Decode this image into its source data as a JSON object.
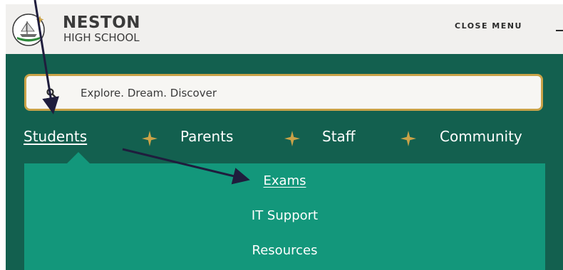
{
  "header": {
    "school_name": "NESTON",
    "school_subtitle": "HIGH SCHOOL",
    "close_menu_label": "CLOSE MENU"
  },
  "search": {
    "placeholder": "Explore. Dream. Discover"
  },
  "nav": {
    "items": [
      {
        "label": "Students",
        "active": true
      },
      {
        "label": "Parents"
      },
      {
        "label": "Staff"
      },
      {
        "label": "Community"
      }
    ],
    "separator_icon": "star-icon"
  },
  "submenu": {
    "items": [
      {
        "label": "Exams",
        "current": true
      },
      {
        "label": "IT Support"
      },
      {
        "label": "Resources"
      }
    ]
  },
  "annotations": {
    "arrow_color": "#1f1d3d"
  },
  "colors": {
    "topbar": "#f1f0ee",
    "panel": "#13604f",
    "submenu": "#13977b",
    "accent_gold": "#c9a248",
    "text_dark": "#3a3a3a"
  }
}
